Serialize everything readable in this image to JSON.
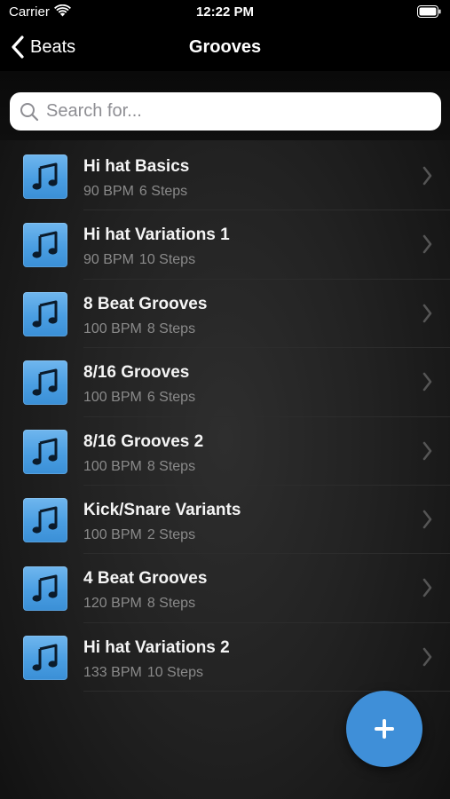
{
  "status_bar": {
    "carrier": "Carrier",
    "time": "12:22 PM"
  },
  "nav": {
    "back_label": "Beats",
    "title": "Grooves"
  },
  "search": {
    "placeholder": "Search for..."
  },
  "colors": {
    "accent": "#3f8fd8",
    "icon_tile": "#4a9ee2"
  },
  "grooves": [
    {
      "title": "Hi hat Basics",
      "bpm": "90 BPM",
      "steps": "6 Steps",
      "icon": "music-note-icon"
    },
    {
      "title": "Hi hat Variations 1",
      "bpm": "90 BPM",
      "steps": "10 Steps",
      "icon": "music-note-icon"
    },
    {
      "title": "8 Beat Grooves",
      "bpm": "100 BPM",
      "steps": "8 Steps",
      "icon": "music-note-icon"
    },
    {
      "title": "8/16 Grooves",
      "bpm": "100 BPM",
      "steps": "6 Steps",
      "icon": "music-note-icon"
    },
    {
      "title": "8/16 Grooves 2",
      "bpm": "100 BPM",
      "steps": "8 Steps",
      "icon": "music-note-icon"
    },
    {
      "title": "Kick/Snare Variants",
      "bpm": "100 BPM",
      "steps": "2 Steps",
      "icon": "music-note-icon"
    },
    {
      "title": "4 Beat Grooves",
      "bpm": "120 BPM",
      "steps": "8 Steps",
      "icon": "music-note-icon"
    },
    {
      "title": "Hi hat Variations 2",
      "bpm": "133 BPM",
      "steps": "10 Steps",
      "icon": "music-note-icon"
    }
  ],
  "fab": {
    "icon": "plus-icon"
  }
}
